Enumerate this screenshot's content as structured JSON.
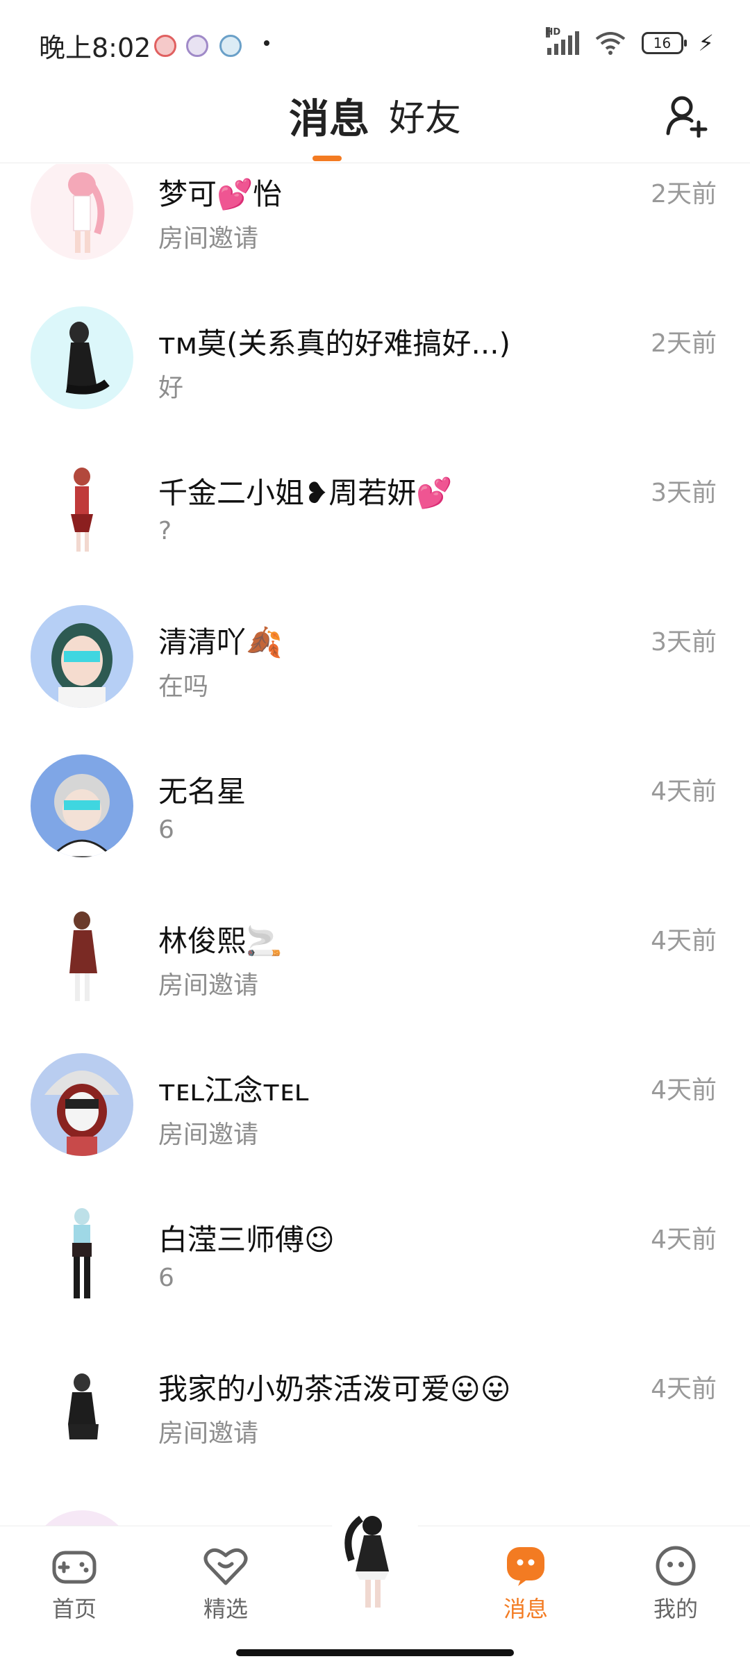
{
  "status_bar": {
    "time": "晚上8:02",
    "network_label": "HD",
    "battery_level": "16"
  },
  "header": {
    "tabs": [
      {
        "label": "消息",
        "active": true
      },
      {
        "label": "好友",
        "active": false
      }
    ],
    "add_friend_icon": "add-user-icon"
  },
  "conversations": [
    {
      "name": "梦可💕怡",
      "preview": "房间邀请",
      "time": "2天前"
    },
    {
      "name": "ᴛᴍ莫(关系真的好难搞好...)",
      "preview": "好",
      "time": "2天前"
    },
    {
      "name": "千金二小姐❥周若妍💕",
      "preview": "?",
      "time": "3天前"
    },
    {
      "name": "清清吖🍂",
      "preview": "在吗",
      "time": "3天前"
    },
    {
      "name": "无名星",
      "preview": "6",
      "time": "4天前"
    },
    {
      "name": "林俊熙🚬",
      "preview": "房间邀请",
      "time": "4天前"
    },
    {
      "name": "ᴛᴇʟ江念ᴛᴇʟ",
      "preview": "房间邀请",
      "time": "4天前"
    },
    {
      "name": "白滢三师傅😉",
      "preview": "6",
      "time": "4天前"
    },
    {
      "name": "我家的小奶茶活泼可爱😛😛",
      "preview": "房间邀请",
      "time": "4天前"
    }
  ],
  "bottom_nav": [
    {
      "label": "首页",
      "icon": "gamepad-icon",
      "active": false
    },
    {
      "label": "精选",
      "icon": "heart-icon",
      "active": false
    },
    {
      "label": "消息",
      "icon": "chat-bubble-icon",
      "active": true
    },
    {
      "label": "我的",
      "icon": "face-icon",
      "active": false
    }
  ],
  "colors": {
    "accent": "#f37b22",
    "muted_text": "#8d8d8d",
    "time_text": "#999999"
  }
}
